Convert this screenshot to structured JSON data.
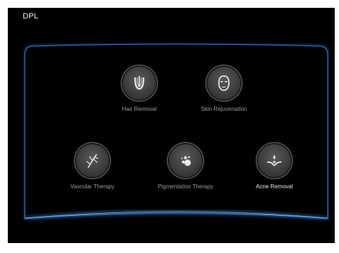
{
  "app": {
    "title": "DPL"
  },
  "treatments": [
    {
      "label": "Hair Removal",
      "icon": "hair-follicle-icon"
    },
    {
      "label": "Skin Rejuvenation",
      "icon": "face-mask-icon"
    },
    {
      "label": "Vascular Therapy",
      "icon": "blood-vessel-icon"
    },
    {
      "label": "Pigmentation Therapy",
      "icon": "pigment-dots-icon"
    },
    {
      "label": "Acne Removal",
      "icon": "acne-icon"
    }
  ],
  "colors": {
    "background": "#000000",
    "frame_glow": "#1e6fd1",
    "icon_circle": "#4a4a4a",
    "label": "#9a9a9a"
  }
}
